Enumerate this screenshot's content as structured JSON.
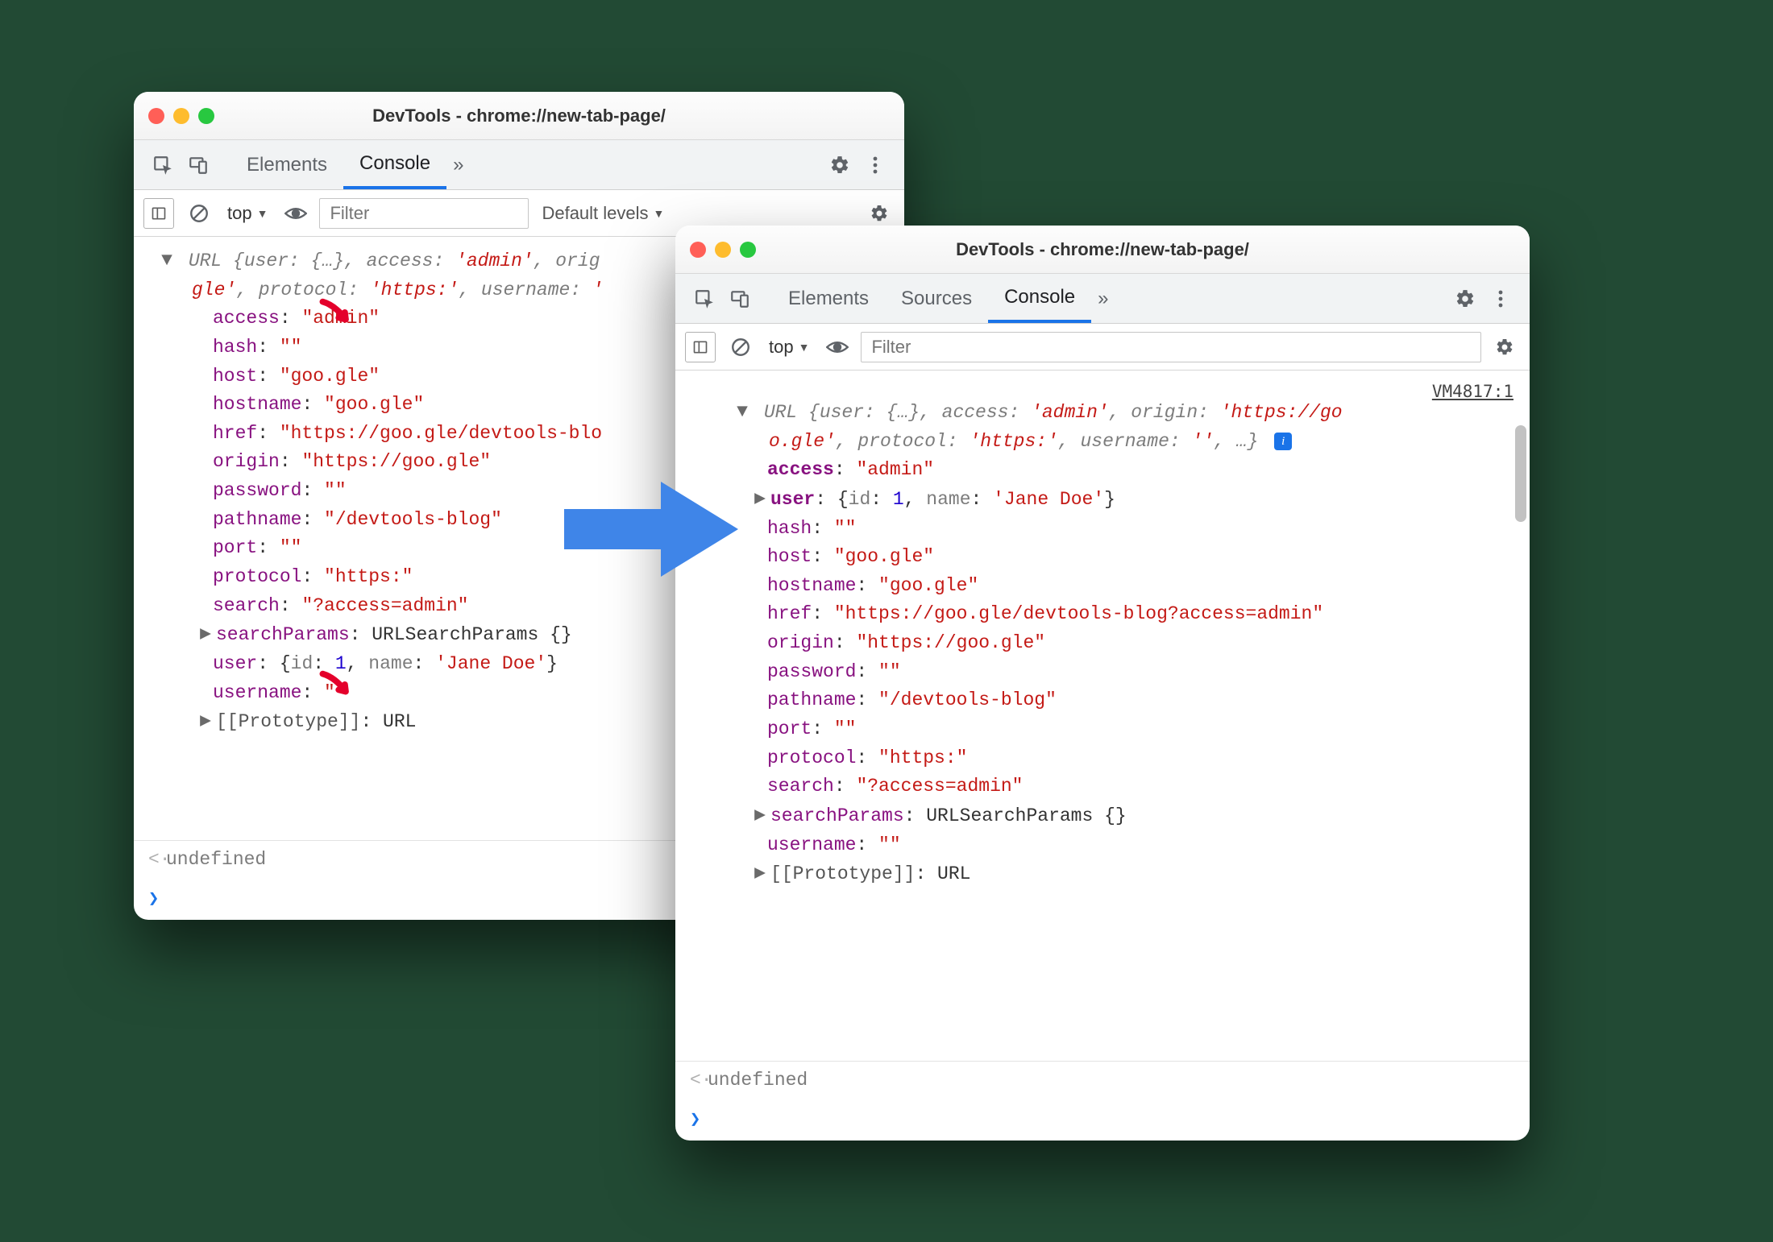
{
  "w1": {
    "title": "DevTools - chrome://new-tab-page/",
    "tabs": {
      "elements": "Elements",
      "console": "Console",
      "more": "»"
    },
    "filter": {
      "top": "top",
      "placeholder": "Filter",
      "levels": "Default levels"
    },
    "summary": {
      "head": "URL {user: {…}, access: ",
      "admin": "'admin'",
      "mid1": ", orig",
      "line2a": "gle'",
      "line2b": ", protocol: ",
      "line2c": "'https:'",
      "line2d": ", username: ",
      "line2e": "'"
    },
    "props": {
      "access_k": "access",
      "access_colon": ": ",
      "access_v": "\"admin\"",
      "hash_k": "hash",
      "hash_colon": ": ",
      "hash_v": "\"\"",
      "host_k": "host",
      "host_colon": ": ",
      "host_v": "\"goo.gle\"",
      "hostname_k": "hostname",
      "hostname_colon": ": ",
      "hostname_v": "\"goo.gle\"",
      "href_k": "href",
      "href_colon": ": ",
      "href_v": "\"https://goo.gle/devtools-blo",
      "origin_k": "origin",
      "origin_colon": ": ",
      "origin_v": "\"https://goo.gle\"",
      "password_k": "password",
      "password_colon": ": ",
      "password_v": "\"\"",
      "pathname_k": "pathname",
      "pathname_colon": ": ",
      "pathname_v": "\"/devtools-blog\"",
      "port_k": "port",
      "port_colon": ": ",
      "port_v": "\"\"",
      "protocol_k": "protocol",
      "protocol_colon": ": ",
      "protocol_v": "\"https:\"",
      "search_k": "search",
      "search_colon": ": ",
      "search_v": "\"?access=admin\"",
      "searchParams_k": "searchParams",
      "searchParams_colon": ": ",
      "searchParams_v": "URLSearchParams {}",
      "user_k": "user",
      "user_colon": ": ",
      "user_open": "{",
      "user_id_k": "id",
      "user_id_colon": ": ",
      "user_id_v": "1",
      "user_sep": ", ",
      "user_name_k": "name",
      "user_name_colon": ": ",
      "user_name_v": "'Jane Doe'",
      "user_close": "}",
      "username_k": "username",
      "username_colon": ": ",
      "username_v": "\"\"",
      "proto_k": "[[Prototype]]",
      "proto_colon": ": ",
      "proto_v": "URL"
    },
    "undefined": "undefined"
  },
  "w2": {
    "title": "DevTools - chrome://new-tab-page/",
    "tabs": {
      "elements": "Elements",
      "sources": "Sources",
      "console": "Console",
      "more": "»"
    },
    "filter": {
      "top": "top",
      "placeholder": "Filter"
    },
    "source_ref": "VM4817:1",
    "summary": {
      "l1a": "URL {user: {…}, access: ",
      "l1b": "'admin'",
      "l1c": ", origin: ",
      "l1d": "'https://go",
      "l2a": "o.gle'",
      "l2b": ", protocol: ",
      "l2c": "'https:'",
      "l2d": ", username: ",
      "l2e": "''",
      "l2f": ", …}"
    },
    "props": {
      "access_k": "access",
      "access_colon": ": ",
      "access_v": "\"admin\"",
      "user_k": "user",
      "user_colon": ": ",
      "user_open": "{",
      "user_id_k": "id",
      "user_id_colon": ": ",
      "user_id_v": "1",
      "user_sep": ", ",
      "user_name_k": "name",
      "user_name_colon": ": ",
      "user_name_v": "'Jane Doe'",
      "user_close": "}",
      "hash_k": "hash",
      "hash_colon": ": ",
      "hash_v": "\"\"",
      "host_k": "host",
      "host_colon": ": ",
      "host_v": "\"goo.gle\"",
      "hostname_k": "hostname",
      "hostname_colon": ": ",
      "hostname_v": "\"goo.gle\"",
      "href_k": "href",
      "href_colon": ": ",
      "href_v": "\"https://goo.gle/devtools-blog?access=admin\"",
      "origin_k": "origin",
      "origin_colon": ": ",
      "origin_v": "\"https://goo.gle\"",
      "password_k": "password",
      "password_colon": ": ",
      "password_v": "\"\"",
      "pathname_k": "pathname",
      "pathname_colon": ": ",
      "pathname_v": "\"/devtools-blog\"",
      "port_k": "port",
      "port_colon": ": ",
      "port_v": "\"\"",
      "protocol_k": "protocol",
      "protocol_colon": ": ",
      "protocol_v": "\"https:\"",
      "search_k": "search",
      "search_colon": ": ",
      "search_v": "\"?access=admin\"",
      "searchParams_k": "searchParams",
      "searchParams_colon": ": ",
      "searchParams_v": "URLSearchParams {}",
      "username_k": "username",
      "username_colon": ": ",
      "username_v": "\"\"",
      "proto_k": "[[Prototype]]",
      "proto_colon": ": ",
      "proto_v": "URL"
    },
    "undefined": "undefined"
  }
}
